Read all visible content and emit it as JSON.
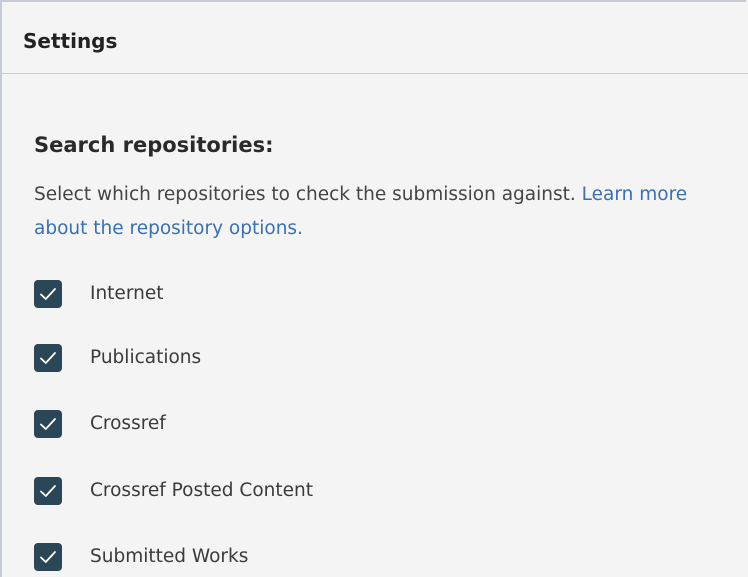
{
  "panel": {
    "title": "Settings"
  },
  "repositories": {
    "heading": "Search repositories:",
    "description": "Select which repositories to check the submission against. ",
    "learn_more_link": "Learn more about the repository options.",
    "checkbox_icon": "checkmark-icon",
    "colors": {
      "checkbox_fill": "#2b4757",
      "link": "#3a6fb0"
    },
    "options": [
      {
        "label": "Internet",
        "checked": true
      },
      {
        "label": "Publications",
        "checked": true
      },
      {
        "label": "Crossref",
        "checked": true
      },
      {
        "label": "Crossref Posted Content",
        "checked": true
      },
      {
        "label": "Submitted Works",
        "checked": true
      }
    ]
  }
}
